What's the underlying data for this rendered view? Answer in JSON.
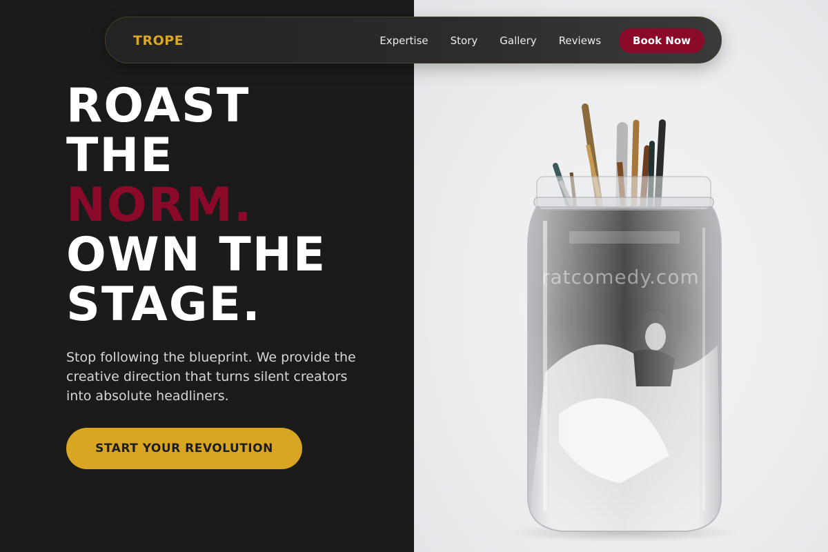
{
  "brand": {
    "name": "TROPE"
  },
  "nav": {
    "links": [
      "Expertise",
      "Story",
      "Gallery",
      "Reviews"
    ],
    "cta": "Book Now"
  },
  "hero": {
    "headline": [
      "ROAST",
      "THE",
      "NORM.",
      "OWN THE",
      "STAGE."
    ],
    "subcopy": "Stop following the blueprint. We provide the creative direction that turns silent creators into absolute headliners.",
    "cta": "START YOUR REVOLUTION"
  },
  "image": {
    "watermark": "ratcomedy.com",
    "subject": "glass jar holding paint brushes with a black-and-white photo inside"
  },
  "colors": {
    "dark_bg": "#1b1b1c",
    "accent_gold": "#d9a623",
    "accent_crimson": "#8b0a29",
    "light_bg": "#ebecee"
  }
}
